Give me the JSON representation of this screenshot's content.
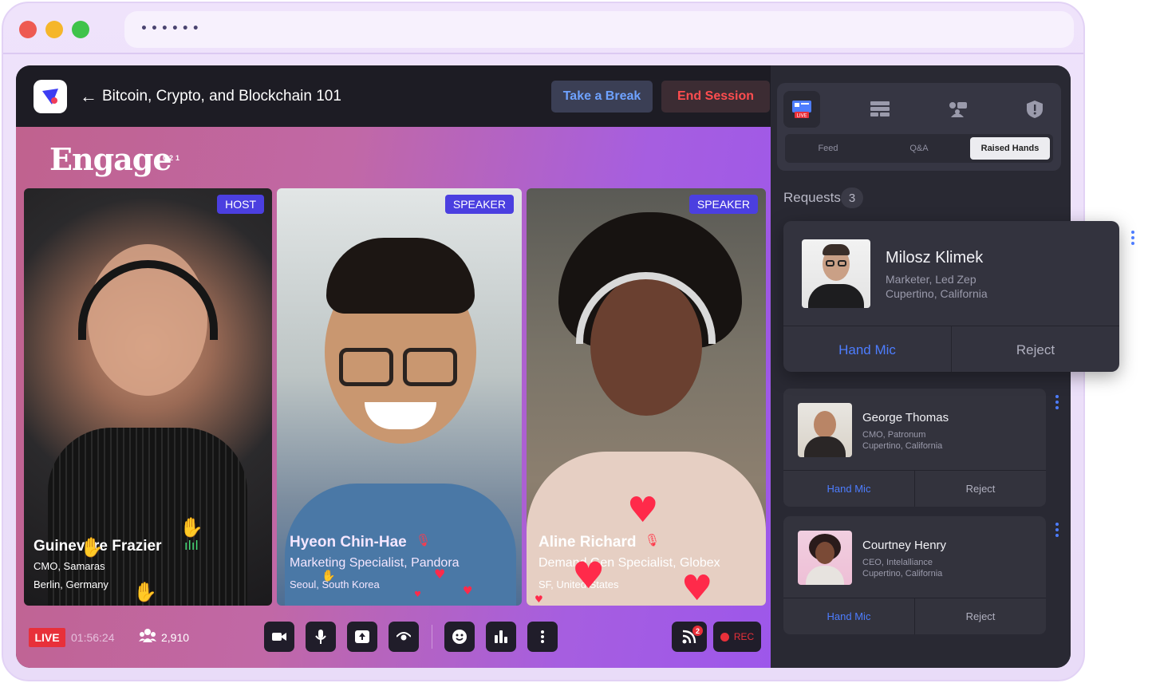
{
  "browser": {
    "traffic_lights": [
      "#ee5a52",
      "#f5b62a",
      "#3fc34a"
    ],
    "address_placeholder": "••••••"
  },
  "topbar": {
    "back_arrow": "←",
    "session_title": "Bitcoin, Crypto, and Blockchain 101",
    "take_break": "Take a Break",
    "end_session": "End Session"
  },
  "stage": {
    "brand": "Engage",
    "brand_year": "2021",
    "tiles": [
      {
        "badge": "HOST",
        "name": "Guinevere Frazier",
        "role": "CMO, Samaras",
        "location": "Berlin, Germany"
      },
      {
        "badge": "SPEAKER",
        "name": "Hyeon Chin-Hae",
        "role": "Marketing Specialist, Pandora",
        "location": "Seoul, South Korea"
      },
      {
        "badge": "SPEAKER",
        "name": "Aline Richard",
        "role": "Demand Gen Specialist, Globex",
        "location": "SF, United States"
      }
    ]
  },
  "controls": {
    "live": "LIVE",
    "timer": "01:56:24",
    "viewers": "2,910",
    "rss_count": "2",
    "rec": "REC"
  },
  "panel": {
    "tabs": [
      "Feed",
      "Q&A",
      "Raised Hands"
    ],
    "active_tab": "Raised Hands",
    "requests_label": "Requests",
    "requests_count": "3",
    "featured": {
      "name": "Milosz Klimek",
      "role": "Marketer, Led Zep",
      "location": "Cupertino, California",
      "accept": "Hand Mic",
      "reject": "Reject"
    },
    "requests": [
      {
        "name": "George Thomas",
        "role": "CMO, Patronum",
        "location": "Cupertino, California",
        "accept": "Hand Mic",
        "reject": "Reject"
      },
      {
        "name": "Courtney Henry",
        "role": "CEO, Intelalliance",
        "location": "Cupertino, California",
        "accept": "Hand Mic",
        "reject": "Reject"
      }
    ]
  },
  "colors": {
    "accent_blue": "#4d7dff",
    "danger": "#e8303a",
    "speaker_badge": "#4b3fe0"
  }
}
